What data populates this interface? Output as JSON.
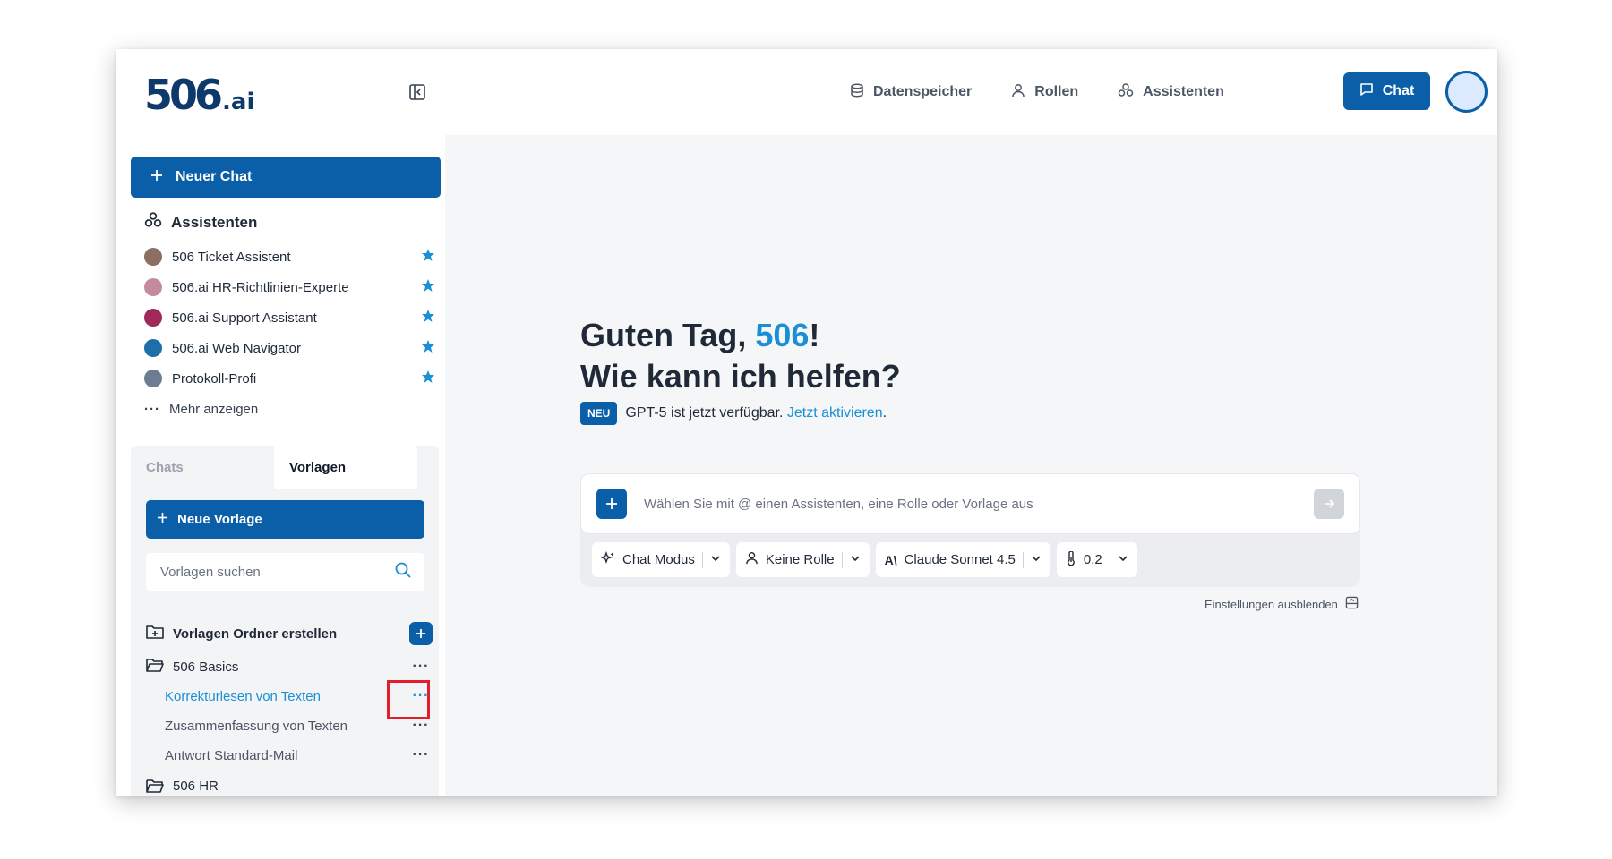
{
  "header": {
    "logo_main": "506",
    "logo_suffix": ".ai",
    "nav": [
      {
        "label": "Datenspeicher",
        "icon": "database-icon"
      },
      {
        "label": "Rollen",
        "icon": "user-icon"
      },
      {
        "label": "Assistenten",
        "icon": "assistants-icon"
      }
    ],
    "chat_button": "Chat"
  },
  "sidebar": {
    "new_chat": "Neuer Chat",
    "assistants_title": "Assistenten",
    "assistants": [
      {
        "name": "506 Ticket Assistent",
        "avatar_color": "#8d6e63"
      },
      {
        "name": "506.ai HR-Richtlinien-Experte",
        "avatar_color": "#c48b9f"
      },
      {
        "name": "506.ai Support Assistant",
        "avatar_color": "#a0285a"
      },
      {
        "name": "506.ai Web Navigator",
        "avatar_color": "#1e6fa8"
      },
      {
        "name": "Protokoll-Profi",
        "avatar_color": "#6b7c93"
      }
    ],
    "more": "Mehr anzeigen",
    "tabs": [
      "Chats",
      "Vorlagen"
    ],
    "new_template": "Neue Vorlage",
    "search_placeholder": "Vorlagen suchen",
    "create_folder": "Vorlagen Ordner erstellen",
    "folders": [
      {
        "name": "506 Basics",
        "templates": [
          "Korrekturlesen von Texten",
          "Zusammenfassung von Texten",
          "Antwort Standard-Mail"
        ]
      },
      {
        "name": "506 HR"
      }
    ]
  },
  "main": {
    "greeting_prefix": "Guten Tag, ",
    "greeting_name": "506",
    "greeting_suffix": "!",
    "greeting_line2": "Wie kann ich helfen?",
    "news_badge": "NEU",
    "news_text": "GPT-5 ist jetzt verfügbar.",
    "news_link": "Jetzt aktivieren",
    "news_end": ".",
    "input_placeholder": "Wählen Sie mit @ einen Assistenten, eine Rolle oder Vorlage aus",
    "options": {
      "mode": "Chat Modus",
      "role": "Keine Rolle",
      "model": "Claude Sonnet 4.5",
      "temperature": "0.2"
    },
    "hide_settings": "Einstellungen ausblenden"
  },
  "colors": {
    "primary": "#0a5fa8",
    "accent": "#1a8fd6",
    "star": "#1a8fd6",
    "highlight": "#e11d2e"
  }
}
